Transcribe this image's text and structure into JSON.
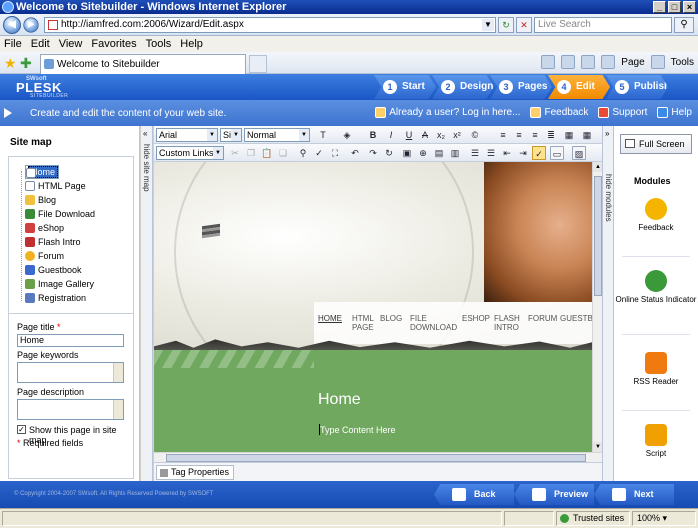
{
  "window": {
    "title": "Welcome to Sitebuilder - Windows Internet Explorer",
    "minimize": "_",
    "maximize": "□",
    "close": "×"
  },
  "address": {
    "url": "http://iamfred.com:2006/Wizard/Edit.aspx",
    "search_placeholder": "Live Search"
  },
  "menu": [
    "File",
    "Edit",
    "View",
    "Favorites",
    "Tools",
    "Help"
  ],
  "tab": {
    "title": "Welcome to Sitebuilder"
  },
  "ie_tools": {
    "page": "Page",
    "tools": "Tools"
  },
  "plesk": {
    "brand_top": "SWsoft",
    "brand": "PLESK",
    "brand_sub": "SITEBUILDER",
    "steps": [
      {
        "num": "1",
        "label": "Start"
      },
      {
        "num": "2",
        "label": "Design"
      },
      {
        "num": "3",
        "label": "Pages"
      },
      {
        "num": "4",
        "label": "Edit"
      },
      {
        "num": "5",
        "label": "Publish"
      }
    ],
    "active_step": "Edit"
  },
  "infobar": {
    "message": "Create and edit the content of your web site.",
    "already_user": "Already a user? Log in here...",
    "feedback": "Feedback",
    "support": "Support",
    "help": "Help"
  },
  "sitemap": {
    "title": "Site map",
    "items": [
      {
        "label": "Home",
        "icon": "page-icon",
        "selected": true
      },
      {
        "label": "HTML Page",
        "icon": "page-icon"
      },
      {
        "label": "Blog",
        "icon": "blog-icon"
      },
      {
        "label": "File Download",
        "icon": "download-icon"
      },
      {
        "label": "eShop",
        "icon": "shop-icon"
      },
      {
        "label": "Flash Intro",
        "icon": "flash-icon"
      },
      {
        "label": "Forum",
        "icon": "forum-icon"
      },
      {
        "label": "Guestbook",
        "icon": "guestbook-icon"
      },
      {
        "label": "Image Gallery",
        "icon": "gallery-icon"
      },
      {
        "label": "Registration",
        "icon": "registration-icon"
      }
    ],
    "hide_label": "hide site map"
  },
  "page_props": {
    "title_label": "Page title",
    "title_value": "Home",
    "keywords_label": "Page keywords",
    "description_label": "Page description",
    "show_in_map": "Show this page in site map",
    "required": "Required fields",
    "asterisk": "*",
    "checkmark": "✓"
  },
  "toolbar": {
    "font": "Arial",
    "size": "Size",
    "format": "Normal",
    "style": "Custom Links"
  },
  "canvas": {
    "nav": [
      "HOME",
      "HTML PAGE",
      "BLOG",
      "FILE DOWNLOAD",
      "ESHOP",
      "FLASH INTRO",
      "FORUM",
      "GUESTBO"
    ],
    "heading": "Home",
    "placeholder": "Type Content Here"
  },
  "tagbar": {
    "label": "Tag Properties"
  },
  "modules": {
    "hide_label": "hide modules",
    "full_screen": "Full Screen",
    "title": "Modules",
    "items": [
      {
        "label": "Feedback",
        "color": "#f5b400"
      },
      {
        "label": "Online Status Indicator",
        "color": "#3a9a3a"
      },
      {
        "label": "RSS Reader",
        "color": "#f07a10"
      },
      {
        "label": "Script",
        "color": "#f0a000"
      }
    ]
  },
  "footer": {
    "copyright": "© Copyright 2004-2007 SWsoft. All Rights Reserved    Powered by    SWSOFT",
    "back": "Back",
    "preview": "Preview",
    "next": "Next"
  },
  "status": {
    "zone": "Trusted sites",
    "zoom": "100%"
  }
}
